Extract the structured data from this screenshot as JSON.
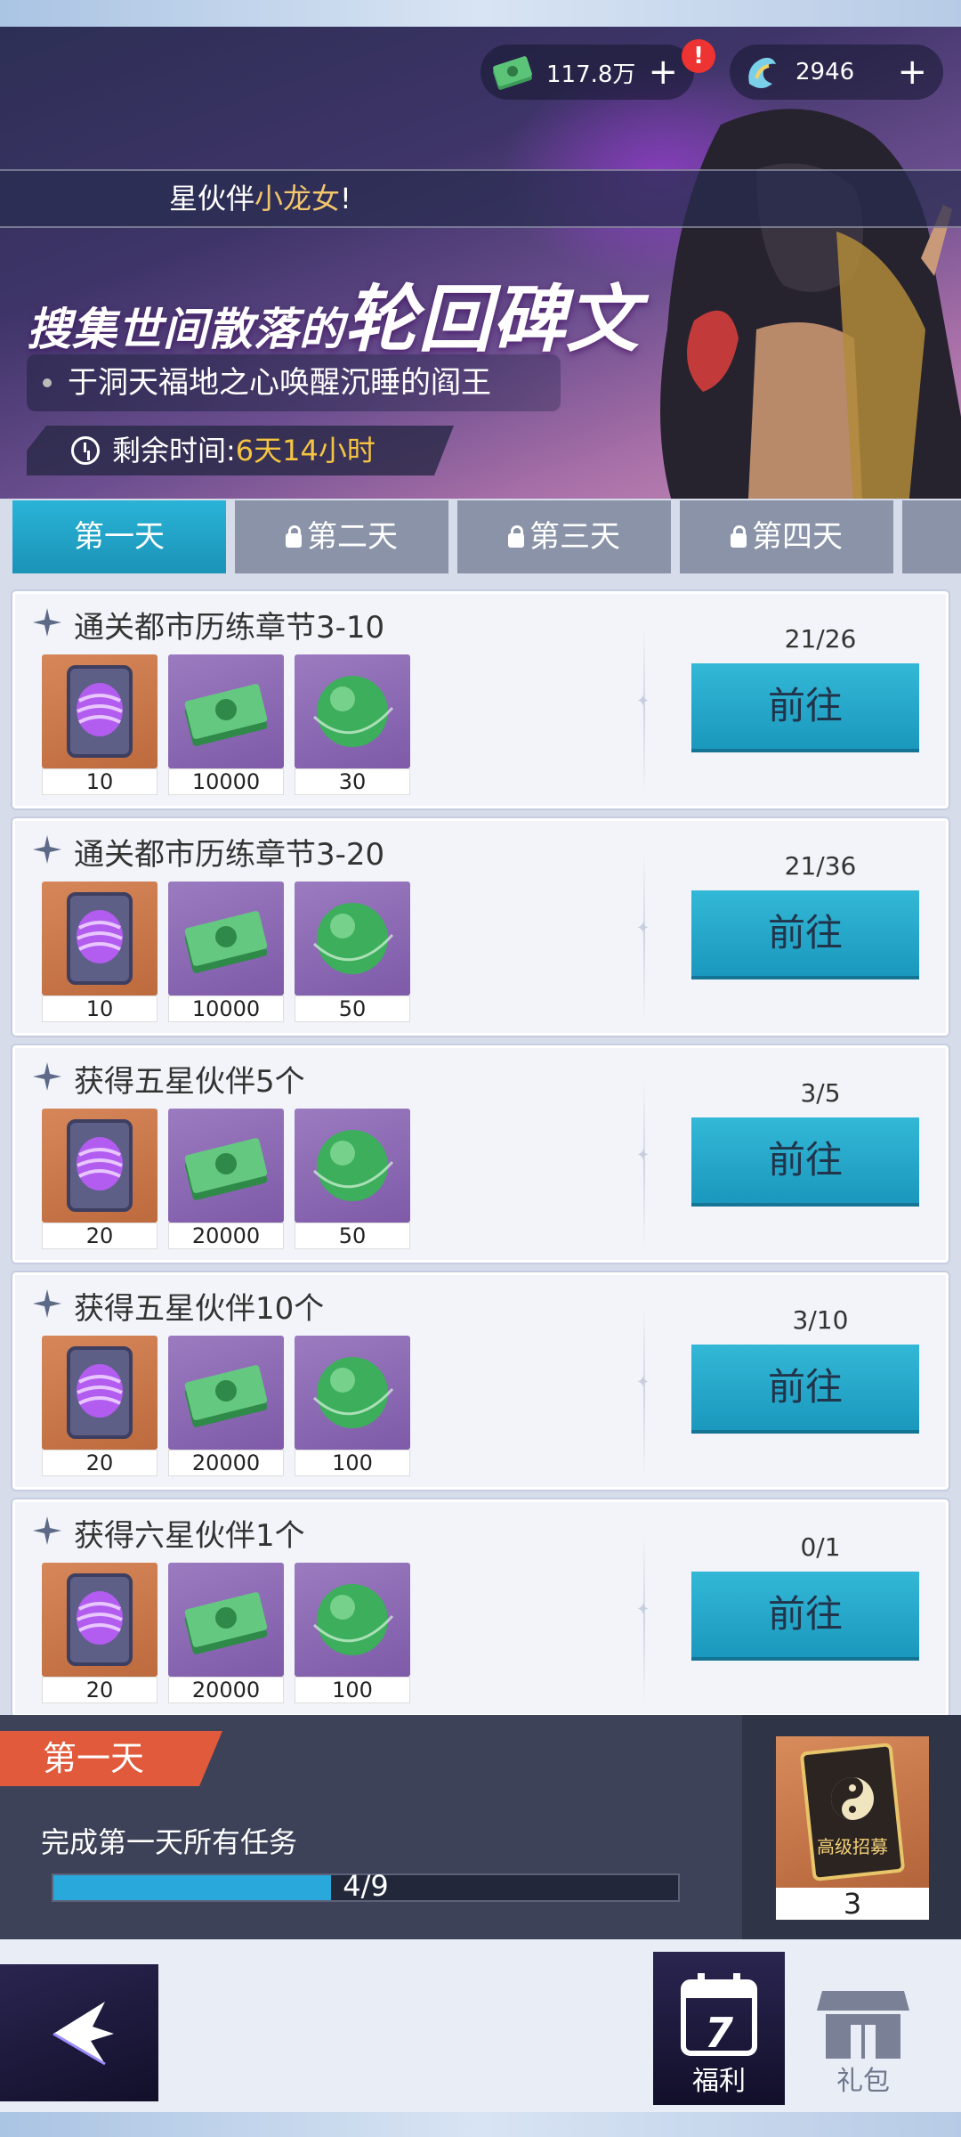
{
  "currency": {
    "money": {
      "amount": "117.8万",
      "icon": "cash-icon"
    },
    "gems": {
      "amount": "2946",
      "icon": "spirit-gem-icon"
    },
    "alert": "!"
  },
  "banner": {
    "marquee_prefix": "星伙伴",
    "marquee_highlight": "小龙女",
    "marquee_suffix": "!",
    "headline_small": "搜集世间散落的",
    "headline_big": "轮回碑文",
    "subline": "于洞天福地之心唤醒沉睡的阎王",
    "timer_label": "剩余时间:",
    "timer_value": "6天14小时"
  },
  "tabs": [
    {
      "label": "第一天",
      "locked": false
    },
    {
      "label": "第二天",
      "locked": true
    },
    {
      "label": "第三天",
      "locked": true
    },
    {
      "label": "第四天",
      "locked": true
    }
  ],
  "go_label": "前往",
  "tasks": [
    {
      "title": "通关都市历练章节3-10",
      "progress": "21/26",
      "rewards": [
        "10",
        "10000",
        "30"
      ]
    },
    {
      "title": "通关都市历练章节3-20",
      "progress": "21/36",
      "rewards": [
        "10",
        "10000",
        "50"
      ]
    },
    {
      "title": "获得五星伙伴5个",
      "progress": "3/5",
      "rewards": [
        "20",
        "20000",
        "50"
      ]
    },
    {
      "title": "获得五星伙伴10个",
      "progress": "3/10",
      "rewards": [
        "20",
        "20000",
        "100"
      ]
    },
    {
      "title": "获得六星伙伴1个",
      "progress": "0/1",
      "rewards": [
        "20",
        "20000",
        "100"
      ]
    }
  ],
  "reward_icons": [
    "rune-scroll-icon",
    "cash-stack-icon",
    "green-orb-icon"
  ],
  "summary": {
    "tag": "第一天",
    "desc": "完成第一天所有任务",
    "progress_text": "4/9",
    "progress_fraction": 0.4444,
    "reward_count": "3",
    "reward_card_text": "高级招募"
  },
  "nav": {
    "welfare_label": "福利",
    "welfare_day": "7",
    "gift_label": "礼包"
  },
  "colors": {
    "accent": "#1a98bd",
    "tag": "#e15a3b",
    "timer": "#f5c542",
    "highlight": "#f3c76b"
  }
}
